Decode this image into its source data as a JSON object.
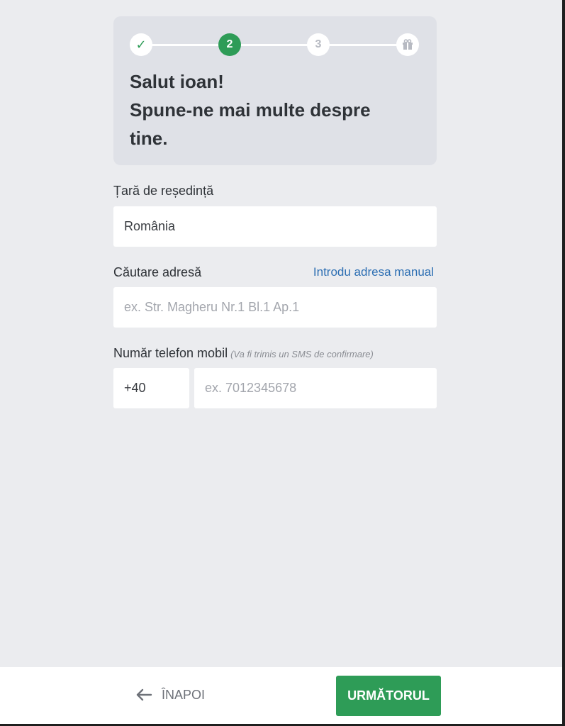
{
  "stepper": {
    "steps": [
      {
        "status": "done",
        "icon": "checkmark-icon",
        "label": "✓"
      },
      {
        "status": "current",
        "label": "2"
      },
      {
        "status": "upcoming",
        "label": "3"
      },
      {
        "status": "upcoming",
        "icon": "gift-icon"
      }
    ],
    "accent_color": "#2e9c57"
  },
  "greeting": {
    "line1": "Salut ioan!",
    "line2": "Spune-ne mai multe despre tine."
  },
  "country": {
    "label": "Țară de reședință",
    "value": "România"
  },
  "address": {
    "label": "Căutare adresă",
    "manual_link": "Introdu adresa manual",
    "placeholder": "ex. Str. Magheru Nr.1 Bl.1 Ap.1"
  },
  "phone": {
    "label": "Număr telefon mobil",
    "hint": "(Va fi trimis un SMS de confirmare)",
    "prefix": "+40",
    "placeholder": "ex. 7012345678"
  },
  "footer": {
    "back_label": "ÎNAPOI",
    "next_label": "URMĂTORUL"
  }
}
